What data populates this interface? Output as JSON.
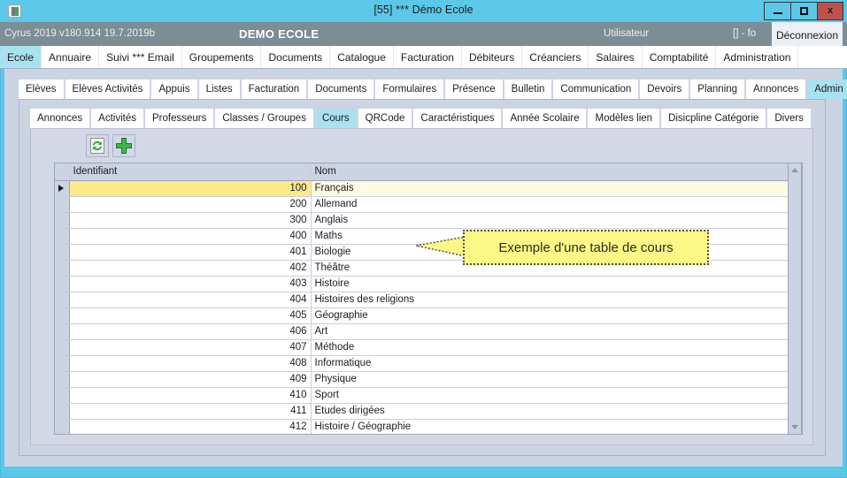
{
  "window": {
    "title": "[55] *** Démo Ecole",
    "icon": "app-icon",
    "controls": {
      "minimize": "minimize-icon",
      "maximize": "maximize-icon",
      "close": "x"
    }
  },
  "app_header": {
    "version": "Cyrus 2019 v180.914 19.7.2019b",
    "brand": "DEMO ECOLE",
    "user_label": "Utilisateur",
    "session": "[] - fo",
    "logout_label": "Déconnexion"
  },
  "menubar": {
    "items": [
      {
        "label": "Ecole",
        "active": true
      },
      {
        "label": "Annuaire",
        "active": false
      },
      {
        "label": "Suivi *** Email",
        "active": false
      },
      {
        "label": "Groupements",
        "active": false
      },
      {
        "label": "Documents",
        "active": false
      },
      {
        "label": "Catalogue",
        "active": false
      },
      {
        "label": "Facturation",
        "active": false
      },
      {
        "label": "Débiteurs",
        "active": false
      },
      {
        "label": "Créanciers",
        "active": false
      },
      {
        "label": "Salaires",
        "active": false
      },
      {
        "label": "Comptabilité",
        "active": false
      },
      {
        "label": "Administration",
        "active": false
      }
    ]
  },
  "tabs_level2": {
    "items": [
      {
        "label": "Elèves",
        "active": false
      },
      {
        "label": "Elèves Activités",
        "active": false
      },
      {
        "label": "Appuis",
        "active": false
      },
      {
        "label": "Listes",
        "active": false
      },
      {
        "label": "Facturation",
        "active": false
      },
      {
        "label": "Documents",
        "active": false
      },
      {
        "label": "Formulaires",
        "active": false
      },
      {
        "label": "Présence",
        "active": false
      },
      {
        "label": "Bulletin",
        "active": false
      },
      {
        "label": "Communication",
        "active": false
      },
      {
        "label": "Devoirs",
        "active": false
      },
      {
        "label": "Planning",
        "active": false
      },
      {
        "label": "Annonces",
        "active": false
      },
      {
        "label": "Admin",
        "active": true
      }
    ]
  },
  "tabs_level3": {
    "items": [
      {
        "label": "Annonces",
        "active": false
      },
      {
        "label": "Activités",
        "active": false
      },
      {
        "label": "Professeurs",
        "active": false
      },
      {
        "label": "Classes / Groupes",
        "active": false
      },
      {
        "label": "Cours",
        "active": true
      },
      {
        "label": "QRCode",
        "active": false
      },
      {
        "label": "Caractéristiques",
        "active": false
      },
      {
        "label": "Année Scolaire",
        "active": false
      },
      {
        "label": "Modèles lien",
        "active": false
      },
      {
        "label": "Disicpline Catégorie",
        "active": false
      },
      {
        "label": "Divers",
        "active": false
      }
    ]
  },
  "toolbar": {
    "refresh_icon": "refresh-icon",
    "add_icon": "add-plus-icon"
  },
  "grid": {
    "columns": [
      "Identifiant",
      "Nom"
    ],
    "rows": [
      {
        "identifiant": "100",
        "nom": "Français",
        "selected": true
      },
      {
        "identifiant": "200",
        "nom": "Allemand",
        "selected": false
      },
      {
        "identifiant": "300",
        "nom": "Anglais",
        "selected": false
      },
      {
        "identifiant": "400",
        "nom": "Maths",
        "selected": false
      },
      {
        "identifiant": "401",
        "nom": "Biologie",
        "selected": false
      },
      {
        "identifiant": "402",
        "nom": "Théâtre",
        "selected": false
      },
      {
        "identifiant": "403",
        "nom": "Histoire",
        "selected": false
      },
      {
        "identifiant": "404",
        "nom": "Histoires des religions",
        "selected": false
      },
      {
        "identifiant": "405",
        "nom": "Géographie",
        "selected": false
      },
      {
        "identifiant": "406",
        "nom": "Art",
        "selected": false
      },
      {
        "identifiant": "407",
        "nom": "Méthode",
        "selected": false
      },
      {
        "identifiant": "408",
        "nom": "Informatique",
        "selected": false
      },
      {
        "identifiant": "409",
        "nom": "Physique",
        "selected": false
      },
      {
        "identifiant": "410",
        "nom": "Sport",
        "selected": false
      },
      {
        "identifiant": "411",
        "nom": "Etudes dirigées",
        "selected": false
      },
      {
        "identifiant": "412",
        "nom": "Histoire / Géographie",
        "selected": false
      },
      {
        "identifiant": "",
        "nom": "",
        "selected": false
      }
    ]
  },
  "annotation": {
    "text": "Exemple d'une table de cours"
  },
  "colors": {
    "window_chrome": "#5bc8e8",
    "header_bar": "#7c8d96",
    "active_tab": "#a9e1ef",
    "panel": "#ccd3e3",
    "selected_row": "#fbe98c",
    "callout": "#fdf885",
    "close_button": "#c0504d"
  }
}
